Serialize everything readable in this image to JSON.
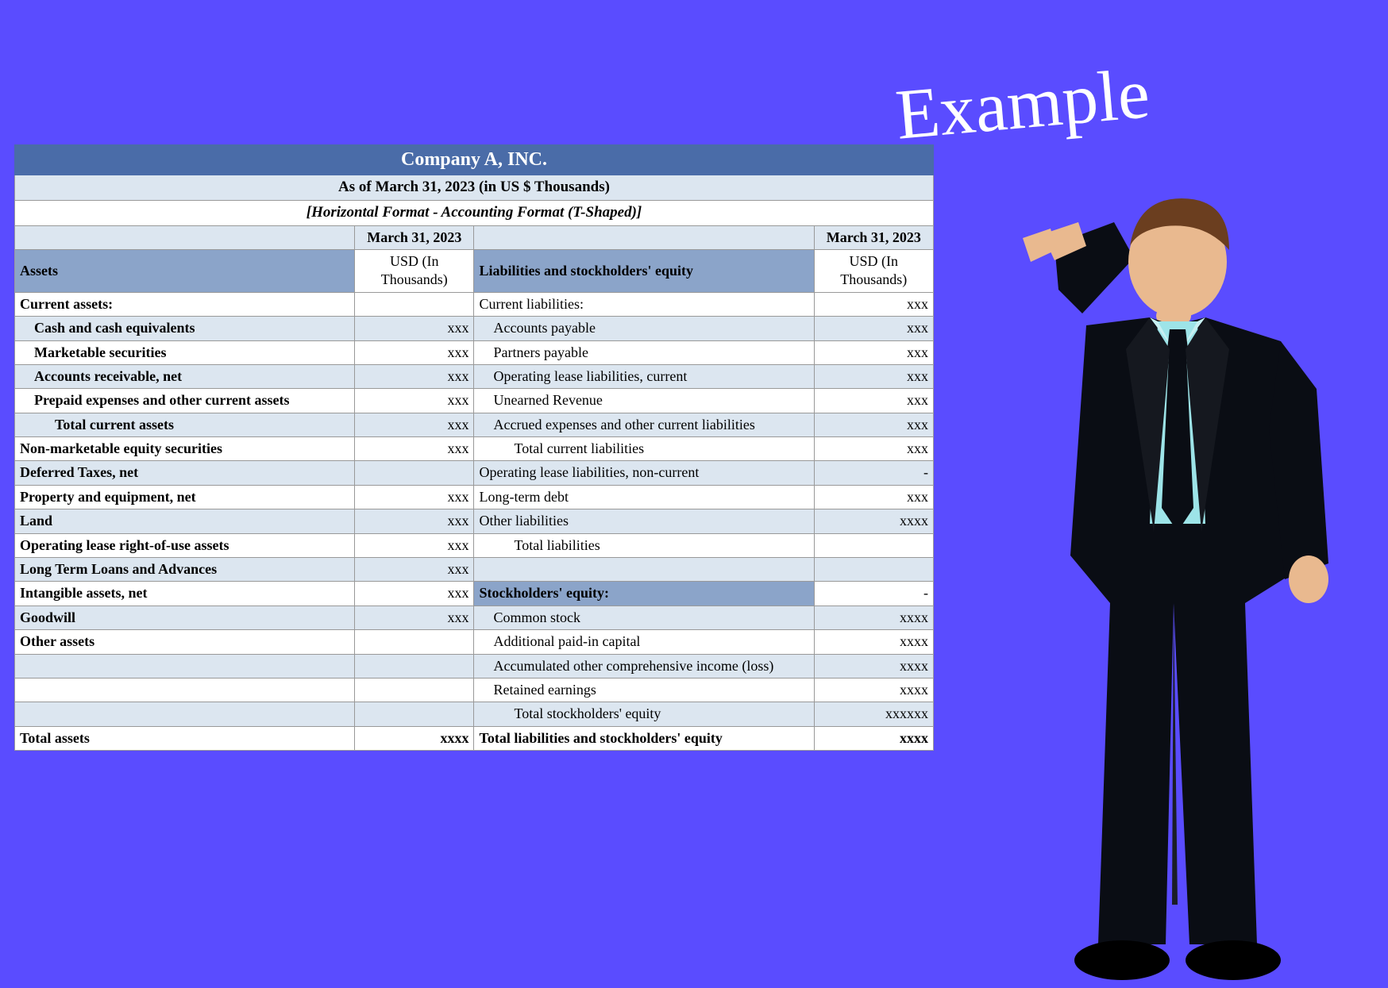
{
  "header": {
    "company": "Company A, INC.",
    "asof": "As of March 31, 2023 (in US $ Thousands)",
    "format": "[Horizontal Format - Accounting Format (T-Shaped)]",
    "date": "March 31, 2023"
  },
  "colheads": {
    "assets": "Assets",
    "usd": "USD (In Thousands)",
    "liab": "Liabilities and stockholders' equity"
  },
  "rows": {
    "r1": {
      "a": "Current assets:",
      "av": "",
      "l": "Current liabilities:",
      "lv": "xxx"
    },
    "r2": {
      "a": "Cash and cash equivalents",
      "av": "xxx",
      "l": "Accounts payable",
      "lv": "xxx"
    },
    "r3": {
      "a": "Marketable securities",
      "av": "xxx",
      "l": "Partners payable",
      "lv": "xxx"
    },
    "r4": {
      "a": "Accounts receivable, net",
      "av": "xxx",
      "l": "Operating lease liabilities, current",
      "lv": "xxx"
    },
    "r5": {
      "a": "Prepaid expenses and other current assets",
      "av": "xxx",
      "l": "Unearned Revenue",
      "lv": "xxx"
    },
    "r6": {
      "a": "Total current assets",
      "av": "xxx",
      "l": "Accrued expenses and other current liabilities",
      "lv": "xxx"
    },
    "r7": {
      "a": "Non-marketable equity securities",
      "av": "xxx",
      "l": "Total current liabilities",
      "lv": "xxx"
    },
    "r8": {
      "a": "Deferred Taxes, net",
      "av": "",
      "l": "Operating lease liabilities, non-current",
      "lv": "-"
    },
    "r9": {
      "a": "Property and equipment, net",
      "av": "xxx",
      "l": "Long-term debt",
      "lv": "xxx"
    },
    "r10": {
      "a": "Land",
      "av": "xxx",
      "l": "Other liabilities",
      "lv": "xxxx"
    },
    "r11": {
      "a": "Operating lease right-of-use assets",
      "av": "xxx",
      "l": "Total liabilities",
      "lv": ""
    },
    "r12": {
      "a": "Long Term Loans and Advances",
      "av": "xxx",
      "l": "",
      "lv": ""
    },
    "r13": {
      "a": "Intangible assets, net",
      "av": "xxx",
      "l": "Stockholders' equity:",
      "lv": "-"
    },
    "r14": {
      "a": "Goodwill",
      "av": "xxx",
      "l": "Common stock",
      "lv": "xxxx"
    },
    "r15": {
      "a": "Other assets",
      "av": "",
      "l": "Additional paid-in capital",
      "lv": "xxxx"
    },
    "r16": {
      "a": "",
      "av": "",
      "l": "Accumulated other comprehensive income (loss)",
      "lv": "xxxx"
    },
    "r17": {
      "a": "",
      "av": "",
      "l": "Retained earnings",
      "lv": "xxxx"
    },
    "r18": {
      "a": "",
      "av": "",
      "l": "Total stockholders' equity",
      "lv": "xxxxxx"
    },
    "r19": {
      "a": "Total assets",
      "av": "xxxx",
      "l": "Total liabilities and stockholders' equity",
      "lv": "xxxx"
    }
  },
  "decor": {
    "example": "Example"
  }
}
